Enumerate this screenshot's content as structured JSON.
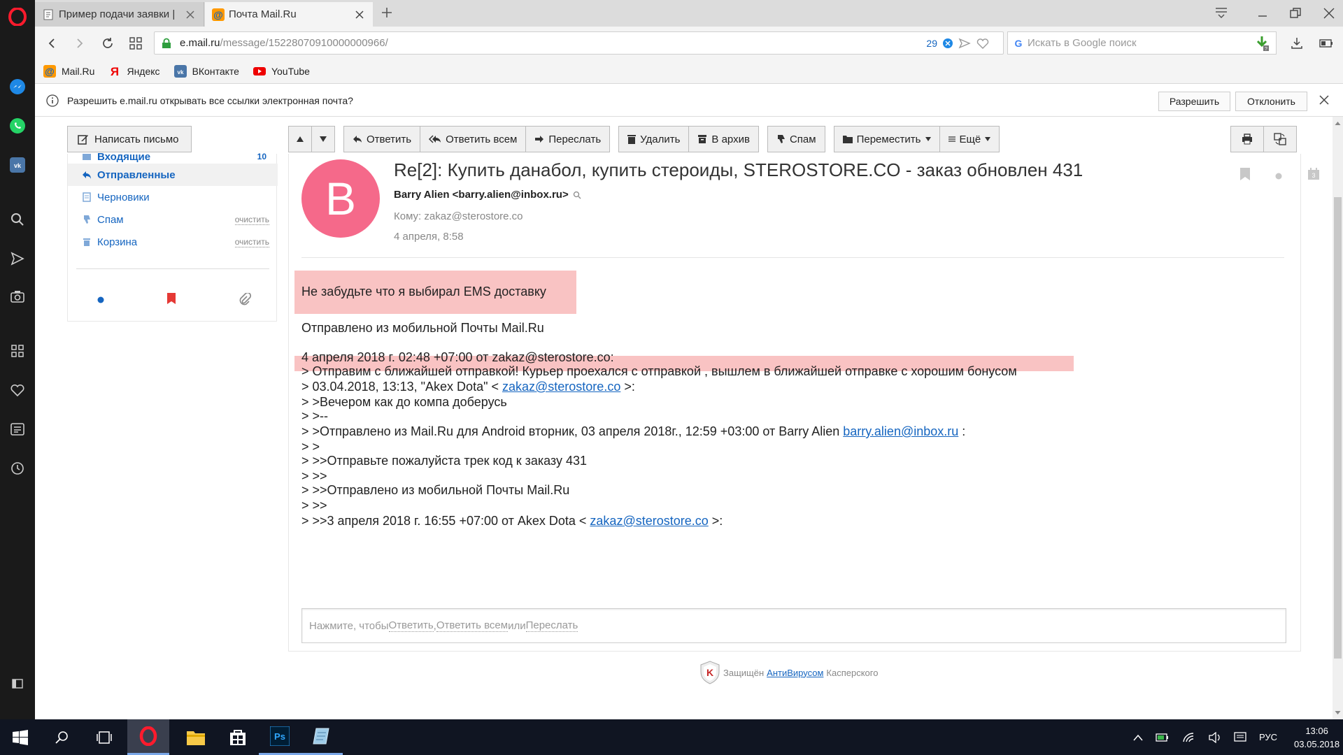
{
  "browser": {
    "tabs": [
      {
        "title": "Пример подачи заявки |"
      },
      {
        "title": "Почта Mail.Ru"
      }
    ],
    "url_host": "e.mail.ru",
    "url_path": "/message/15228070910000000966/",
    "badge_count": "29",
    "search_placeholder": "Искать в Google поиск",
    "bookmarks": [
      "Mail.Ru",
      "Яндекс",
      "ВКонтакте",
      "YouTube"
    ],
    "infobar": {
      "text": "Разрешить e.mail.ru открывать все ссылки электронная почта?",
      "allow": "Разрешить",
      "deny": "Отклонить"
    }
  },
  "mail": {
    "compose_label": "Написать письмо",
    "folders": [
      {
        "label": "Входящие",
        "count": "10"
      },
      {
        "label": "Отправленные"
      },
      {
        "label": "Черновики"
      },
      {
        "label": "Спам",
        "action": "очистить"
      },
      {
        "label": "Корзина",
        "action": "очистить"
      }
    ],
    "toolbar": {
      "reply": "Ответить",
      "reply_all": "Ответить всем",
      "forward": "Переслать",
      "delete": "Удалить",
      "archive": "В архив",
      "spam": "Спам",
      "move": "Переместить",
      "more": "Ещё"
    },
    "message": {
      "avatar_letter": "B",
      "subject": "Re[2]: Купить данабол, купить стероиды, STEROSTORE.CO - заказ обновлен 431",
      "from": "Barry Alien <barry.alien@inbox.ru>",
      "to": "Кому: zakaz@sterostore.co",
      "date": "4 апреля, 8:58",
      "body": {
        "l1": "Не забудьте что я выбирал EMS доставку",
        "l2": "Отправлено из мобильной Почты Mail.Ru",
        "l3": "4 апреля 2018 г. 02:48 +07:00 от zakaz@sterostore.co:",
        "l4": "> Отправим с ближайшей отправкой! Курьер проехался с отправкой , вышлем в ближайшей отправке с хорошим бонусом",
        "l5a": "> 03.04.2018, 13:13, \"Akex Dota\" < ",
        "l5link": "zakaz@sterostore.co",
        "l5b": " >:",
        "l6": "> >Вечером как до компа доберусь",
        "l7": "> >--",
        "l8a": "> >Отправлено из Mail.Ru для Android вторник, 03 апреля 2018г., 12:59 +03:00 от Barry Alien ",
        "l8link": "barry.alien@inbox.ru",
        "l8b": " :",
        "l9": "> >",
        "l10": "> >>Отправьте пожалуйста трек код к заказу 431",
        "l11": "> >>",
        "l12": "> >>Отправлено из мобильной Почты Mail.Ru",
        "l13": "> >>",
        "l14a": "> >>3 апреля 2018 г. 16:55 +07:00 от Akex Dota < ",
        "l14link": "zakaz@sterostore.co",
        "l14b": " >:"
      }
    },
    "reply_box": {
      "prefix": "Нажмите, чтобы ",
      "reply": "Ответить",
      "sep": ", ",
      "reply_all": "Ответить всем",
      "or": " или ",
      "forward": "Переслать"
    },
    "kaspersky": {
      "prefix": "Защищён",
      "link": "АнтиВирусом",
      "suffix": "Касперского"
    }
  },
  "taskbar": {
    "lang": "РУС",
    "time": "13:06",
    "date": "03.05.2018"
  },
  "colors": {
    "accent": "#1565c0",
    "highlight": "#f9c3c3",
    "avatar": "#f5698a",
    "opera_red": "#ff1b2d"
  }
}
